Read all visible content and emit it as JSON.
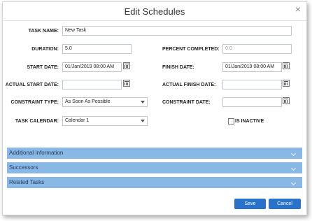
{
  "dialog": {
    "title": "Edit Schedules",
    "close_label": "×"
  },
  "fields": {
    "task_name": {
      "label": "TASK NAME:",
      "value": "New Task"
    },
    "duration": {
      "label": "DURATION:",
      "value": "5.0"
    },
    "percent_completed": {
      "label": "PERCENT COMPLETED:",
      "value": "0.0"
    },
    "start_date": {
      "label": "START DATE:",
      "value": "01/Jan/2019 08:00 AM"
    },
    "finish_date": {
      "label": "FINISH DATE:",
      "value": "01/Jan/2019 08:00 AM"
    },
    "actual_start_date": {
      "label": "ACTUAL START DATE:",
      "value": ""
    },
    "actual_finish_date": {
      "label": "ACTUAL FINISH DATE:",
      "value": ""
    },
    "constraint_type": {
      "label": "CONSTRAINT TYPE:",
      "value": "As Soon As Possible"
    },
    "constraint_date": {
      "label": "CONSTRAINT DATE:",
      "value": ""
    },
    "task_calendar": {
      "label": "TASK CALENDAR:",
      "value": "Calendar 1"
    },
    "is_inactive": {
      "label": "IS INACTIVE",
      "checked": false
    }
  },
  "sections": [
    {
      "label": "Additional Information"
    },
    {
      "label": "Successors"
    },
    {
      "label": "Related Tasks"
    }
  ],
  "buttons": {
    "save": "Save",
    "cancel": "Cancel"
  },
  "colors": {
    "accordion": "#8ab8e6",
    "button": "#2a72c9"
  }
}
